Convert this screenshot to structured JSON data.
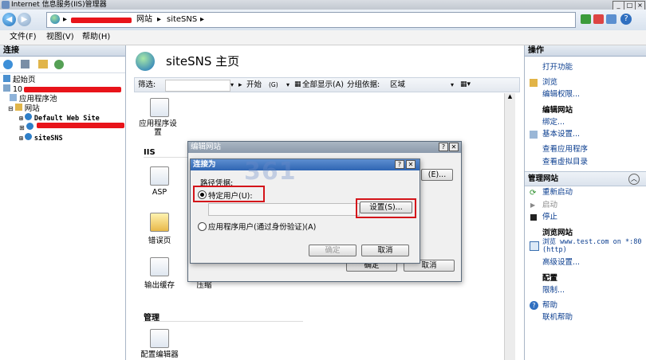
{
  "window": {
    "title": "Internet 信息服务(IIS)管理器"
  },
  "address": {
    "crumb_site_group": "网站",
    "crumb_site": "siteSNS",
    "sep": "▸"
  },
  "menu": {
    "file": "文件(F)",
    "view": "视图(V)",
    "help": "帮助(H)"
  },
  "left": {
    "header": "连接",
    "tree": {
      "start": "起始页",
      "server_prefix": "10",
      "app_pools": "应用程序池",
      "sites": "网站",
      "default_site": "Default Web Site",
      "site_sns": "siteSNS"
    }
  },
  "center": {
    "title": "siteSNS 主页",
    "filter_label": "筛选:",
    "start_label": "开始",
    "start_key": "(G)",
    "show_all_label": "全部显示(A)",
    "group_label": "分组依据:",
    "group_value": "区域",
    "features_top": "应用程序设置",
    "section_iis": "IIS",
    "asp": "ASP",
    "error_pages": "错误页",
    "output_cache": "输出缓存",
    "compression": "压缩",
    "section_manage": "管理",
    "config_editor": "配置编辑器"
  },
  "edit_site_dialog": {
    "title": "编辑网站",
    "help_btn": "?",
    "close_btn": "✕",
    "behind_btn_e": "(E)...",
    "ok_btn": "确定",
    "cancel_btn": "取消"
  },
  "connect_as_dialog": {
    "title": "连接为",
    "help_btn": "?",
    "close_btn": "✕",
    "group_label": "路径凭据:",
    "specific_user": "特定用户(U):",
    "settings_btn": "设置(S)...",
    "app_user": "应用程序用户(通过身份验证)(A)",
    "ok_btn": "确定",
    "cancel_btn": "取消"
  },
  "watermark": "361",
  "right": {
    "header": "操作",
    "open_feature": "打开功能",
    "explore": "浏览",
    "edit_permissions": "编辑权限...",
    "edit_site_head": "编辑网站",
    "bindings": "绑定...",
    "basic_settings": "基本设置...",
    "view_apps": "查看应用程序",
    "view_vdirs": "查看虚拟目录",
    "manage_site_head": "管理网站",
    "restart": "重新启动",
    "start": "启动",
    "stop": "停止",
    "browse_site_head": "浏览网站",
    "browse_url_line1": "浏览 www.test.com on *:80",
    "browse_url_line2": "(http)",
    "advanced_settings": "高级设置...",
    "config_head": "配置",
    "limits": "限制...",
    "help": "帮助",
    "online_help": "联机帮助"
  },
  "colors": {
    "redact": "#e8141a",
    "highlight": "#d4141a",
    "link": "#0a3d8f"
  }
}
